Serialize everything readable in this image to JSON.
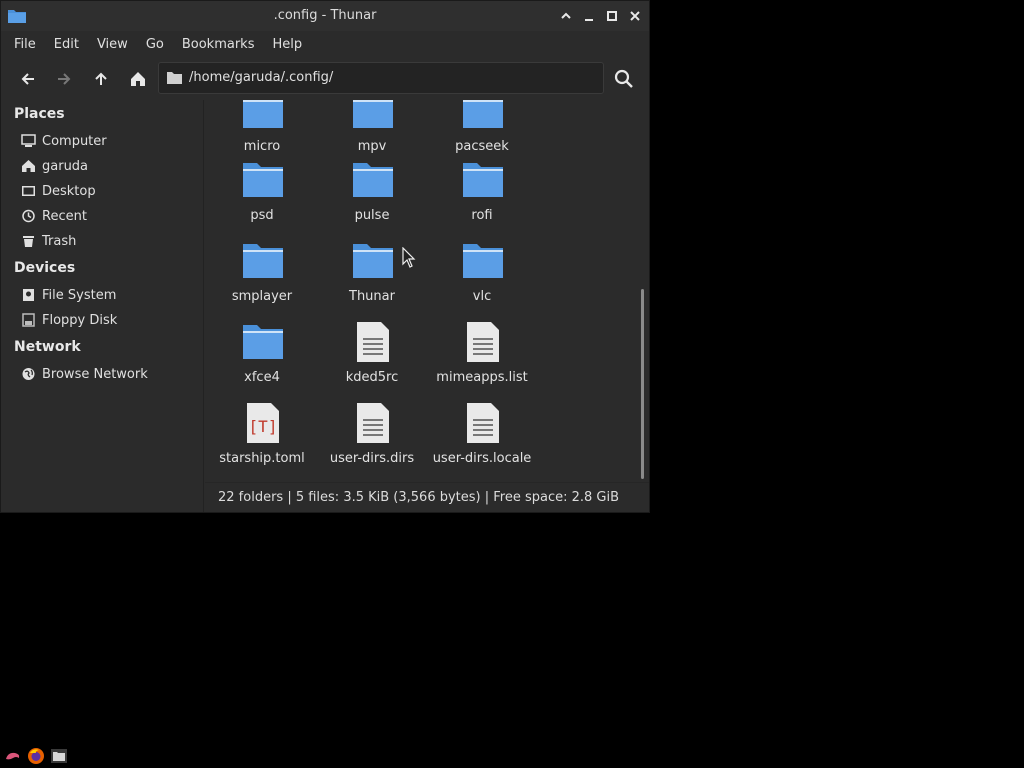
{
  "window": {
    "title": ".config - Thunar"
  },
  "menubar": {
    "items": [
      "File",
      "Edit",
      "View",
      "Go",
      "Bookmarks",
      "Help"
    ]
  },
  "toolbar": {
    "path": "/home/garuda/.config/"
  },
  "sidebar": {
    "places_heading": "Places",
    "places": [
      {
        "label": "Computer",
        "icon": "computer-icon"
      },
      {
        "label": "garuda",
        "icon": "home-icon"
      },
      {
        "label": "Desktop",
        "icon": "desktop-icon"
      },
      {
        "label": "Recent",
        "icon": "recent-icon"
      },
      {
        "label": "Trash",
        "icon": "trash-icon"
      }
    ],
    "devices_heading": "Devices",
    "devices": [
      {
        "label": "File System",
        "icon": "drive-icon"
      },
      {
        "label": "Floppy Disk",
        "icon": "floppy-icon"
      }
    ],
    "network_heading": "Network",
    "network": [
      {
        "label": "Browse Network",
        "icon": "network-icon"
      }
    ]
  },
  "files": [
    {
      "name": "micro",
      "type": "folder"
    },
    {
      "name": "mpv",
      "type": "folder"
    },
    {
      "name": "pacseek",
      "type": "folder"
    },
    {
      "name": "psd",
      "type": "folder"
    },
    {
      "name": "pulse",
      "type": "folder"
    },
    {
      "name": "rofi",
      "type": "folder"
    },
    {
      "name": "smplayer",
      "type": "folder"
    },
    {
      "name": "Thunar",
      "type": "folder"
    },
    {
      "name": "vlc",
      "type": "folder"
    },
    {
      "name": "xfce4",
      "type": "folder"
    },
    {
      "name": "kded5rc",
      "type": "text"
    },
    {
      "name": "mimeapps.list",
      "type": "text"
    },
    {
      "name": "starship.toml",
      "type": "toml"
    },
    {
      "name": "user-dirs.dirs",
      "type": "text"
    },
    {
      "name": "user-dirs.locale",
      "type": "text"
    }
  ],
  "statusbar": {
    "text": "22 folders  |  5 files: 3.5 KiB (3,566 bytes)  |  Free space: 2.8 GiB"
  },
  "colors": {
    "folder_blue": "#4a90d9",
    "window_bg": "#2b2b2b",
    "desktop_bg": "#000000"
  }
}
